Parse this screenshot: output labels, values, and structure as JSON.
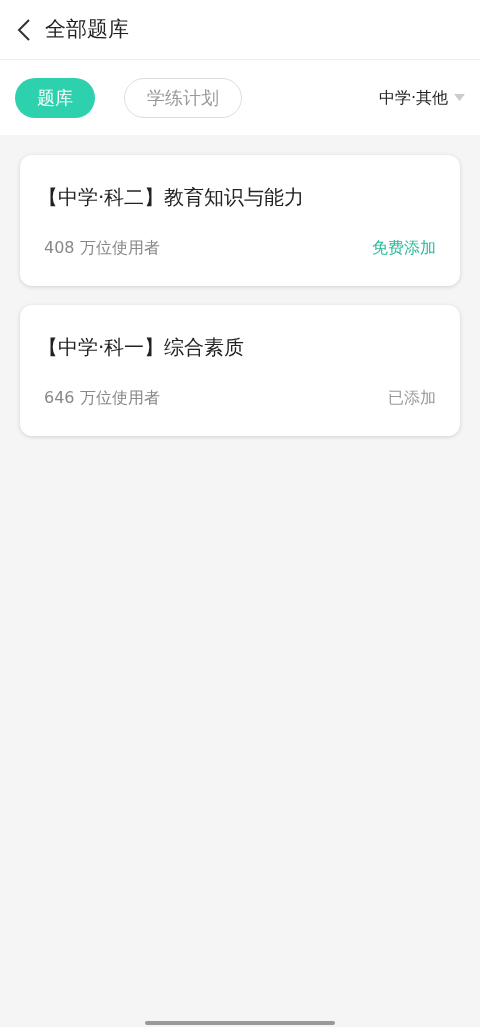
{
  "header": {
    "title": "全部题库"
  },
  "tabs": [
    {
      "label": "题库",
      "selected": true
    },
    {
      "label": "学练计划",
      "selected": false
    }
  ],
  "filter": {
    "label": "中学·其他"
  },
  "banks": [
    {
      "title": "【中学·科二】教育知识与能力",
      "users": "408 万位使用者",
      "action": "免费添加",
      "added": false
    },
    {
      "title": "【中学·科一】综合素质",
      "users": "646 万位使用者",
      "action": "已添加",
      "added": true
    }
  ]
}
